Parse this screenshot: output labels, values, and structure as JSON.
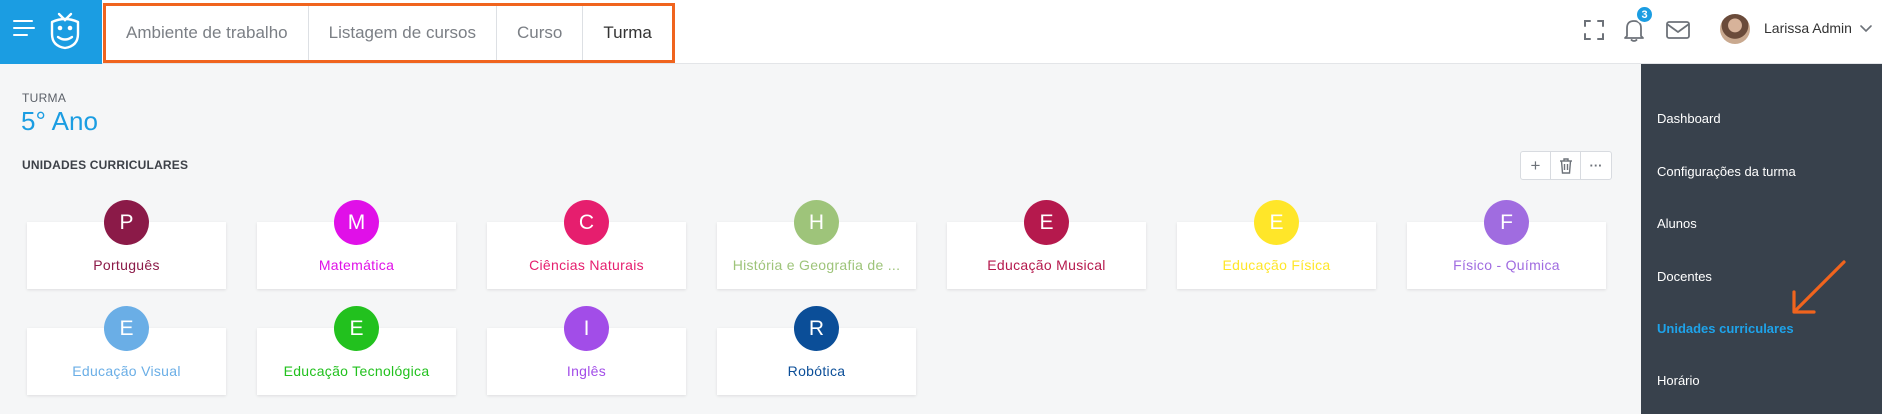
{
  "header": {
    "menu_icon": "hamburger-menu-icon",
    "logo_icon": "owl-logo-icon",
    "breadcrumbs": [
      "Ambiente de trabalho",
      "Listagem de cursos",
      "Curso",
      "Turma"
    ],
    "notification_count": "3",
    "user_name": "Larissa Admin"
  },
  "main": {
    "kicker": "TURMA",
    "title": "5° Ano",
    "units_heading": "UNIDADES CURRICULARES",
    "toolbar": {
      "add_label": "+",
      "more_label": "···"
    },
    "units": [
      {
        "letter": "P",
        "name": "Português",
        "color": "#8b1a48"
      },
      {
        "letter": "M",
        "name": "Matemática",
        "color": "#e010e8"
      },
      {
        "letter": "C",
        "name": "Ciências Naturais",
        "color": "#e61e6e"
      },
      {
        "letter": "H",
        "name": "História e Geografia de ...",
        "color": "#9ec47a"
      },
      {
        "letter": "E",
        "name": "Educação Musical",
        "color": "#b5194d"
      },
      {
        "letter": "E",
        "name": "Educação Física",
        "color": "#ffe629"
      },
      {
        "letter": "F",
        "name": "Físico - Química",
        "color": "#a06ce0"
      },
      {
        "letter": "E",
        "name": "Educação Visual",
        "color": "#6aaee6"
      },
      {
        "letter": "E",
        "name": "Educação Tecnológica",
        "color": "#22c11e"
      },
      {
        "letter": "I",
        "name": "Inglês",
        "color": "#a24de8"
      },
      {
        "letter": "R",
        "name": "Robótica",
        "color": "#0b4e98"
      }
    ]
  },
  "sidebar": {
    "items": [
      {
        "label": "Dashboard",
        "active": false
      },
      {
        "label": "Configurações da turma",
        "active": false
      },
      {
        "label": "Alunos",
        "active": false
      },
      {
        "label": "Docentes",
        "active": false
      },
      {
        "label": "Unidades curriculares",
        "active": true
      },
      {
        "label": "Horário",
        "active": false
      }
    ]
  },
  "colors": {
    "brand": "#1b9de2",
    "highlight": "#f0641e",
    "sidebar_bg": "#38414c"
  }
}
